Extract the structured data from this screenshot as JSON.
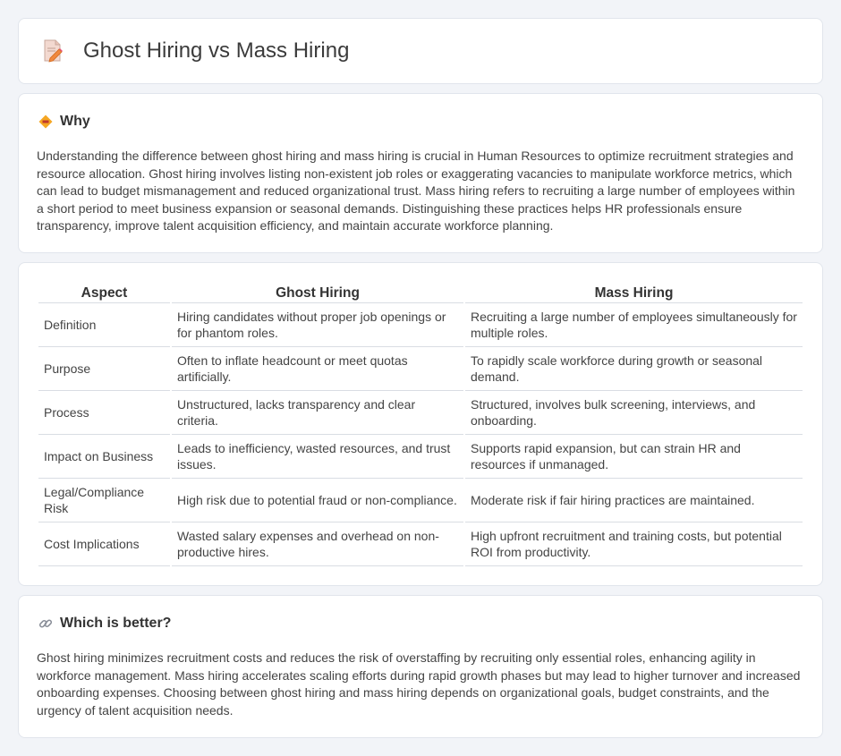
{
  "header": {
    "title": "Ghost Hiring vs Mass Hiring",
    "icon": "document-edit-icon"
  },
  "why": {
    "icon": "diamond-warning-icon",
    "title": "Why",
    "text": "Understanding the difference between ghost hiring and mass hiring is crucial in Human Resources to optimize recruitment strategies and resource allocation. Ghost hiring involves listing non-existent job roles or exaggerating vacancies to manipulate workforce metrics, which can lead to budget mismanagement and reduced organizational trust. Mass hiring refers to recruiting a large number of employees within a short period to meet business expansion or seasonal demands. Distinguishing these practices helps HR professionals ensure transparency, improve talent acquisition efficiency, and maintain accurate workforce planning."
  },
  "table": {
    "headers": [
      "Aspect",
      "Ghost Hiring",
      "Mass Hiring"
    ],
    "rows": [
      [
        "Definition",
        "Hiring candidates without proper job openings or for phantom roles.",
        "Recruiting a large number of employees simultaneously for multiple roles."
      ],
      [
        "Purpose",
        "Often to inflate headcount or meet quotas artificially.",
        "To rapidly scale workforce during growth or seasonal demand."
      ],
      [
        "Process",
        "Unstructured, lacks transparency and clear criteria.",
        "Structured, involves bulk screening, interviews, and onboarding."
      ],
      [
        "Impact on Business",
        "Leads to inefficiency, wasted resources, and trust issues.",
        "Supports rapid expansion, but can strain HR and resources if unmanaged."
      ],
      [
        "Legal/Compliance Risk",
        "High risk due to potential fraud or non-compliance.",
        "Moderate risk if fair hiring practices are maintained."
      ],
      [
        "Cost Implications",
        "Wasted salary expenses and overhead on non-productive hires.",
        "High upfront recruitment and training costs, but potential ROI from productivity."
      ]
    ]
  },
  "better": {
    "icon": "link-icon",
    "title": "Which is better?",
    "text": "Ghost hiring minimizes recruitment costs and reduces the risk of overstaffing by recruiting only essential roles, enhancing agility in workforce management. Mass hiring accelerates scaling efforts during rapid growth phases but may lead to higher turnover and increased onboarding expenses. Choosing between ghost hiring and mass hiring depends on organizational goals, budget constraints, and the urgency of talent acquisition needs."
  },
  "colors": {
    "background": "#f2f4f8",
    "card": "#ffffff",
    "accent_orange": "#f5a623",
    "icon_pink": "#e8557a"
  }
}
